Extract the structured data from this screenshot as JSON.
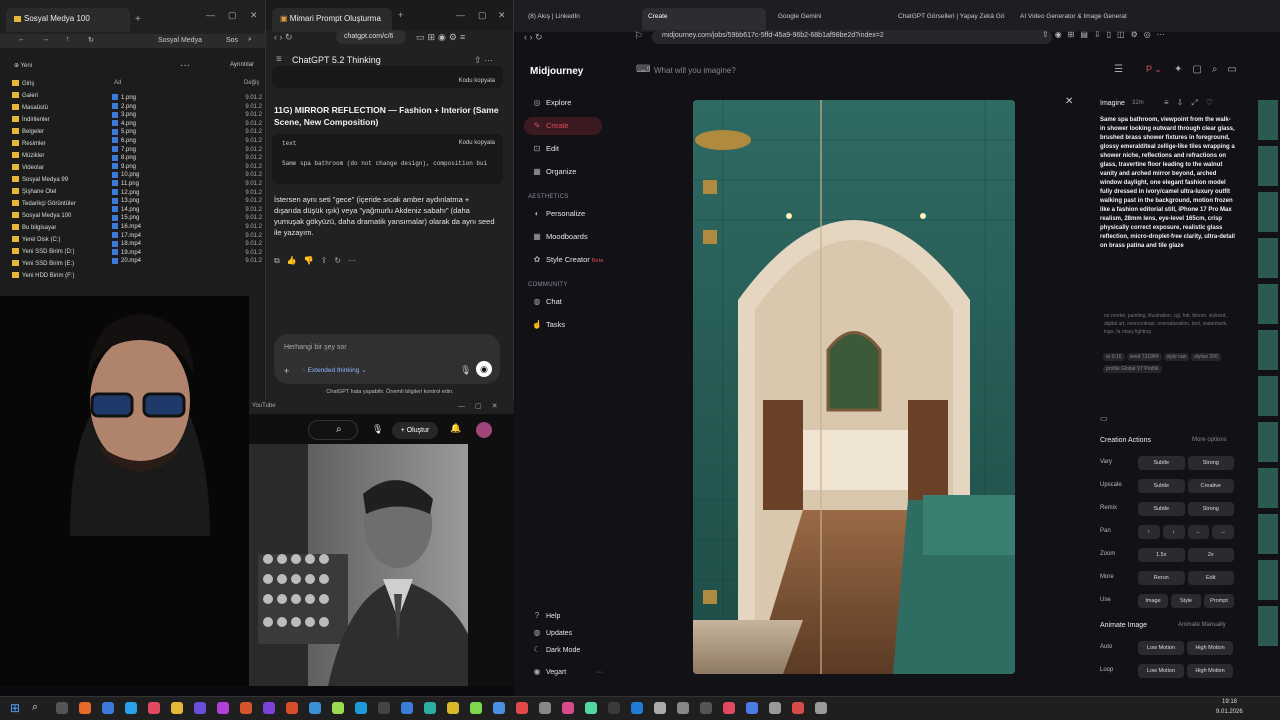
{
  "explorer": {
    "tab_title": "Sosyal Medya 100",
    "breadcrumb": "Sosyal Medya",
    "search_placeholder": "Sos",
    "new_label": "Yeni",
    "view_label": "Ayrıntılar",
    "col_name": "Ad",
    "col_date": "Değiş",
    "nav_items": [
      "Giriş",
      "Galeri",
      "Masaüstü",
      "İndirilenler",
      "Belgeler",
      "Resimler",
      "Müzikler",
      "Videolar",
      "Sosyal Medya 99",
      "Şişhane Otel",
      "Tedarikçi Görüntüler",
      "Sosyal Medya 100",
      "Bu bilgisayar",
      "Yerel Disk (C:)",
      "Yeni SSD Birim (D:)",
      "Yeni SSD Birim (E:)",
      "Yeni HDD Birim (F:)"
    ],
    "files": [
      "1.png",
      "2.png",
      "3.png",
      "4.png",
      "5.png",
      "6.png",
      "7.png",
      "8.png",
      "9.png",
      "10.png",
      "11.png",
      "12.png",
      "13.png",
      "14.png",
      "15.png",
      "16.mp4",
      "17.mp4",
      "18.mp4",
      "19.mp4",
      "20.mp4"
    ],
    "file_date": "9.01.2"
  },
  "chatgpt": {
    "tab_title": "Mimari Prompt Oluşturma",
    "url": "chatgpt.com/c/6",
    "model": "ChatGPT 5.2 Thinking",
    "copy_label": "Kodu kopyala",
    "section_title": "11G) MIRROR REFLECTION — Fashion + Interior (Same Scene, New Composition)",
    "code_lang": "text",
    "code_text": "Same spa bathroom (do not change design), composition bui",
    "body_text": "İstersen aynı seti \"gece\" (içeride sıcak amber aydınlatma + dışarıda düşük ışık) veya \"yağmurlu Akdeniz sabahı\" (daha yumuşak gökyüzü, daha dramatik yansımalar) olarak da aynı seed ile yazayım.",
    "input_placeholder": "Herhangi bir şey sor",
    "mode_label": "Extended thinking",
    "disclaimer": "ChatGPT hata yapabilir. Önemli bilgileri kontrol edin."
  },
  "youtube": {
    "create_label": "Oluştur",
    "title": "YouTube"
  },
  "mj": {
    "tabs": [
      "(8) Akış | LinkedIn",
      "Create",
      "Google Gemini",
      "ChatGPT Görselleri | Yapay Zekâ Gö",
      "AI Video Generator & Image Generat"
    ],
    "url": "midjourney.com/jobs/59bb617c-5ffd-45a9-96b2-68b1af98be2d?index=2",
    "brand": "Midjourney",
    "search_placeholder": "What will you imagine?",
    "nav": {
      "explore": "Explore",
      "create": "Create",
      "edit": "Edit",
      "organize": "Organize",
      "aesthetics": "AESTHETICS",
      "personalize": "Personalize",
      "moodboards": "Moodboards",
      "style_creator": "Style Creator",
      "beta": "Beta",
      "community": "COMMUNITY",
      "chat": "Chat",
      "tasks": "Tasks",
      "help": "Help",
      "updates": "Updates",
      "dark_mode": "Dark Mode",
      "user": "Vegart"
    },
    "panel": {
      "type": "Imagine",
      "age": "32m",
      "prompt": "Same spa bathroom, viewpoint from the walk-in shower looking outward through clear glass, brushed brass shower fixtures in foreground, glossy emerald/teal zellige-like tiles wrapping a shower niche, reflections and refractions on glass, travertine floor leading to the walnut vanity and arched mirror beyond, arched window daylight, one elegant fashion model fully dressed in ivory/camel ultra-luxury outfit walking past in the background, motion frozen like a fashion editorial still, iPhone 17 Pro Max realism, 28mm lens, eye-level 165cm, crisp physically correct exposure, realistic glass reflection, micro-droplet-free clarity, ultra-detail on brass patina and tile glaze",
      "negative": "no render, painting, illustration, cgi, hdr, bloom, stylized, digital art, overcontrast, oversaturation, text, watermark, logo, fa ntasy lighting",
      "params": [
        "ar 9:16",
        "seed 731984",
        "style raw",
        "stylize 200",
        "profile Global V7 Profile"
      ],
      "creation_actions": "Creation Actions",
      "more_options": "More options",
      "rows": [
        {
          "label": "Vary",
          "buttons": [
            "Subtle",
            "Strong"
          ]
        },
        {
          "label": "Upscale",
          "buttons": [
            "Subtle",
            "Creative"
          ]
        },
        {
          "label": "Remix",
          "buttons": [
            "Subtle",
            "Strong"
          ]
        },
        {
          "label": "Pan",
          "buttons": [
            "↑",
            "↓",
            "←",
            "→"
          ]
        },
        {
          "label": "Zoom",
          "buttons": [
            "1.5x",
            "2x"
          ]
        },
        {
          "label": "More",
          "buttons": [
            "Rerun",
            "Edit"
          ]
        },
        {
          "label": "Use",
          "buttons": [
            "Image",
            "Style",
            "Prompt"
          ]
        }
      ],
      "animate_title": "Animate Image",
      "animate_manually": "Animate Manually",
      "animate_rows": [
        {
          "label": "Auto",
          "buttons": [
            "Low Motion",
            "High Motion"
          ]
        },
        {
          "label": "Loop",
          "buttons": [
            "Low Motion",
            "High Motion"
          ]
        }
      ]
    }
  },
  "taskbar": {
    "time": "19:18",
    "date": "9.01.2026"
  },
  "colors": {
    "mj_accent": "#e04a5f",
    "tile_teal": "#2a7a6e",
    "explorer_folder": "#e6b83a"
  }
}
